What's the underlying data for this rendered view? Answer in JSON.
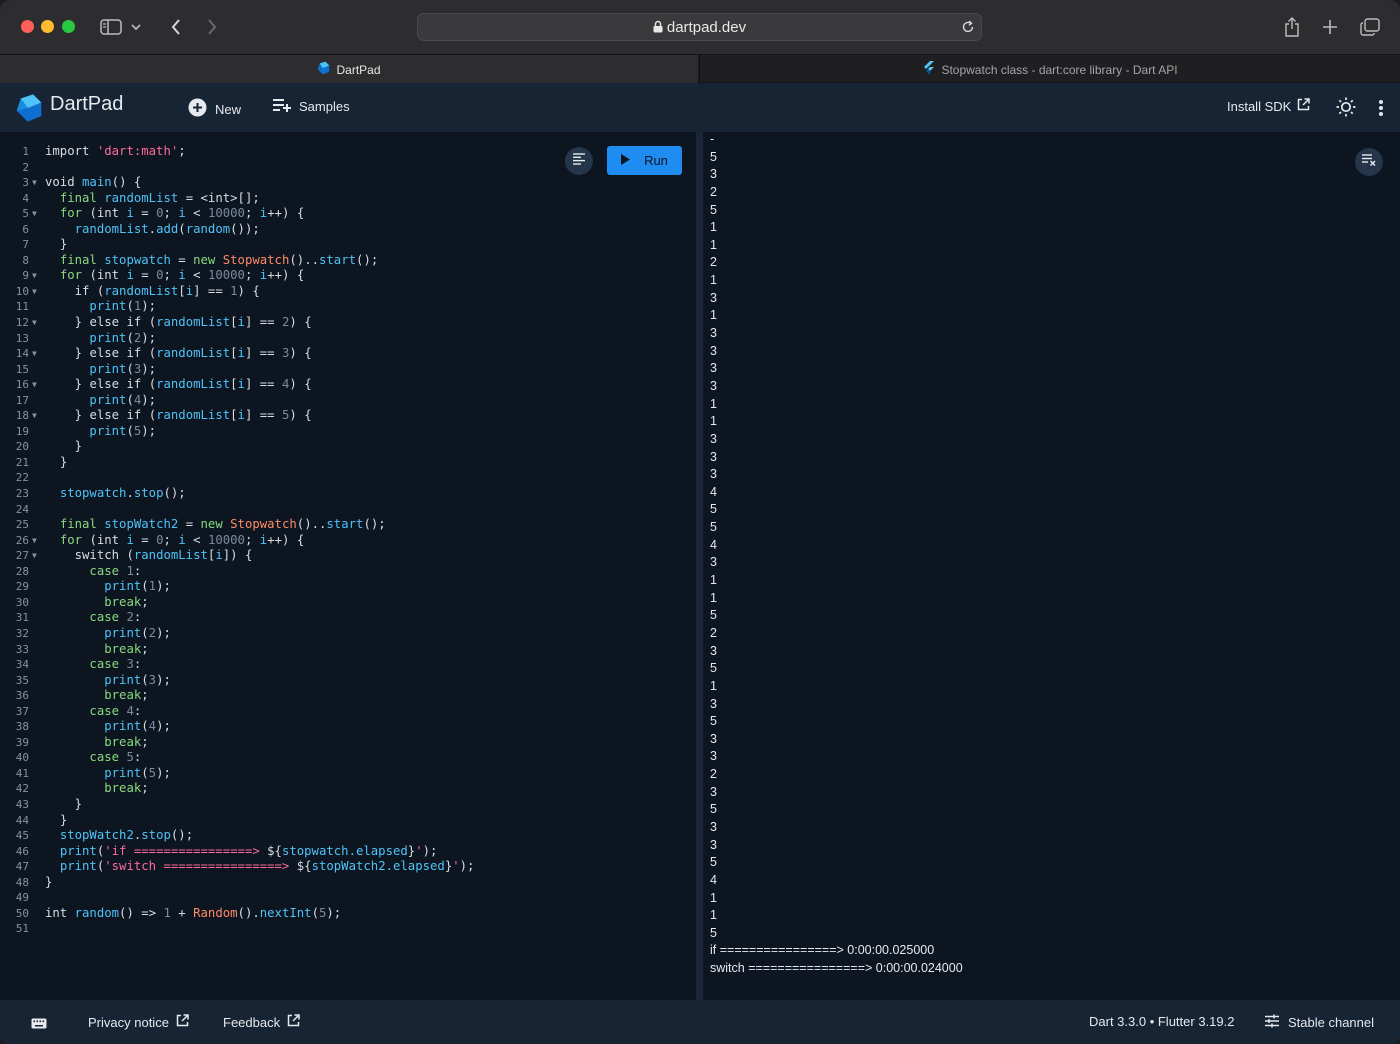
{
  "browser": {
    "url": "dartpad.dev",
    "tabs": [
      {
        "label": "DartPad",
        "active": true
      },
      {
        "label": "Stopwatch class - dart:core library - Dart API",
        "active": false
      }
    ]
  },
  "app": {
    "title": "DartPad",
    "new_label": "New",
    "samples_label": "Samples",
    "install_sdk_label": "Install SDK",
    "run_label": "Run",
    "accent": "#1e8cf0",
    "background": "#0d1520"
  },
  "editor": {
    "lines": [
      {
        "n": "1",
        "fold": false,
        "code": "import 'dart:math';"
      },
      {
        "n": "2",
        "fold": false,
        "code": ""
      },
      {
        "n": "3",
        "fold": true,
        "code": "void main() {"
      },
      {
        "n": "4",
        "fold": false,
        "code": "  final randomList = <int>[];"
      },
      {
        "n": "5",
        "fold": true,
        "code": "  for (int i = 0; i < 10000; i++) {"
      },
      {
        "n": "6",
        "fold": false,
        "code": "    randomList.add(random());"
      },
      {
        "n": "7",
        "fold": false,
        "code": "  }"
      },
      {
        "n": "8",
        "fold": false,
        "code": "  final stopwatch = new Stopwatch()..start();"
      },
      {
        "n": "9",
        "fold": true,
        "code": "  for (int i = 0; i < 10000; i++) {"
      },
      {
        "n": "10",
        "fold": true,
        "code": "    if (randomList[i] == 1) {"
      },
      {
        "n": "11",
        "fold": false,
        "code": "      print(1);"
      },
      {
        "n": "12",
        "fold": true,
        "code": "    } else if (randomList[i] == 2) {"
      },
      {
        "n": "13",
        "fold": false,
        "code": "      print(2);"
      },
      {
        "n": "14",
        "fold": true,
        "code": "    } else if (randomList[i] == 3) {"
      },
      {
        "n": "15",
        "fold": false,
        "code": "      print(3);"
      },
      {
        "n": "16",
        "fold": true,
        "code": "    } else if (randomList[i] == 4) {"
      },
      {
        "n": "17",
        "fold": false,
        "code": "      print(4);"
      },
      {
        "n": "18",
        "fold": true,
        "code": "    } else if (randomList[i] == 5) {"
      },
      {
        "n": "19",
        "fold": false,
        "code": "      print(5);"
      },
      {
        "n": "20",
        "fold": false,
        "code": "    }"
      },
      {
        "n": "21",
        "fold": false,
        "code": "  }"
      },
      {
        "n": "22",
        "fold": false,
        "code": ""
      },
      {
        "n": "23",
        "fold": false,
        "code": "  stopwatch.stop();"
      },
      {
        "n": "24",
        "fold": false,
        "code": ""
      },
      {
        "n": "25",
        "fold": false,
        "code": "  final stopWatch2 = new Stopwatch()..start();"
      },
      {
        "n": "26",
        "fold": true,
        "code": "  for (int i = 0; i < 10000; i++) {"
      },
      {
        "n": "27",
        "fold": true,
        "code": "    switch (randomList[i]) {"
      },
      {
        "n": "28",
        "fold": false,
        "code": "      case 1:"
      },
      {
        "n": "29",
        "fold": false,
        "code": "        print(1);"
      },
      {
        "n": "30",
        "fold": false,
        "code": "        break;"
      },
      {
        "n": "31",
        "fold": false,
        "code": "      case 2:"
      },
      {
        "n": "32",
        "fold": false,
        "code": "        print(2);"
      },
      {
        "n": "33",
        "fold": false,
        "code": "        break;"
      },
      {
        "n": "34",
        "fold": false,
        "code": "      case 3:"
      },
      {
        "n": "35",
        "fold": false,
        "code": "        print(3);"
      },
      {
        "n": "36",
        "fold": false,
        "code": "        break;"
      },
      {
        "n": "37",
        "fold": false,
        "code": "      case 4:"
      },
      {
        "n": "38",
        "fold": false,
        "code": "        print(4);"
      },
      {
        "n": "39",
        "fold": false,
        "code": "        break;"
      },
      {
        "n": "40",
        "fold": false,
        "code": "      case 5:"
      },
      {
        "n": "41",
        "fold": false,
        "code": "        print(5);"
      },
      {
        "n": "42",
        "fold": false,
        "code": "        break;"
      },
      {
        "n": "43",
        "fold": false,
        "code": "    }"
      },
      {
        "n": "44",
        "fold": false,
        "code": "  }"
      },
      {
        "n": "45",
        "fold": false,
        "code": "  stopWatch2.stop();"
      },
      {
        "n": "46",
        "fold": false,
        "code": "  print('if ================> ${stopwatch.elapsed}');"
      },
      {
        "n": "47",
        "fold": false,
        "code": "  print('switch ================> ${stopWatch2.elapsed}');"
      },
      {
        "n": "48",
        "fold": false,
        "code": "}"
      },
      {
        "n": "49",
        "fold": false,
        "code": ""
      },
      {
        "n": "50",
        "fold": false,
        "code": "int random() => 1 + Random().nextInt(5);"
      },
      {
        "n": "51",
        "fold": false,
        "code": ""
      }
    ]
  },
  "console": {
    "lines": [
      "-",
      "5",
      "3",
      "2",
      "5",
      "1",
      "1",
      "2",
      "1",
      "3",
      "1",
      "3",
      "3",
      "3",
      "3",
      "1",
      "1",
      "3",
      "3",
      "3",
      "4",
      "5",
      "5",
      "4",
      "3",
      "1",
      "1",
      "5",
      "2",
      "3",
      "5",
      "1",
      "3",
      "5",
      "3",
      "3",
      "2",
      "3",
      "5",
      "3",
      "3",
      "5",
      "4",
      "1",
      "1",
      "5",
      "if ================> 0:00:00.025000",
      "switch ================> 0:00:00.024000"
    ]
  },
  "footer": {
    "privacy_label": "Privacy notice",
    "feedback_label": "Feedback",
    "version_label": "Dart 3.3.0 • Flutter 3.19.2",
    "channel_label": "Stable channel"
  }
}
